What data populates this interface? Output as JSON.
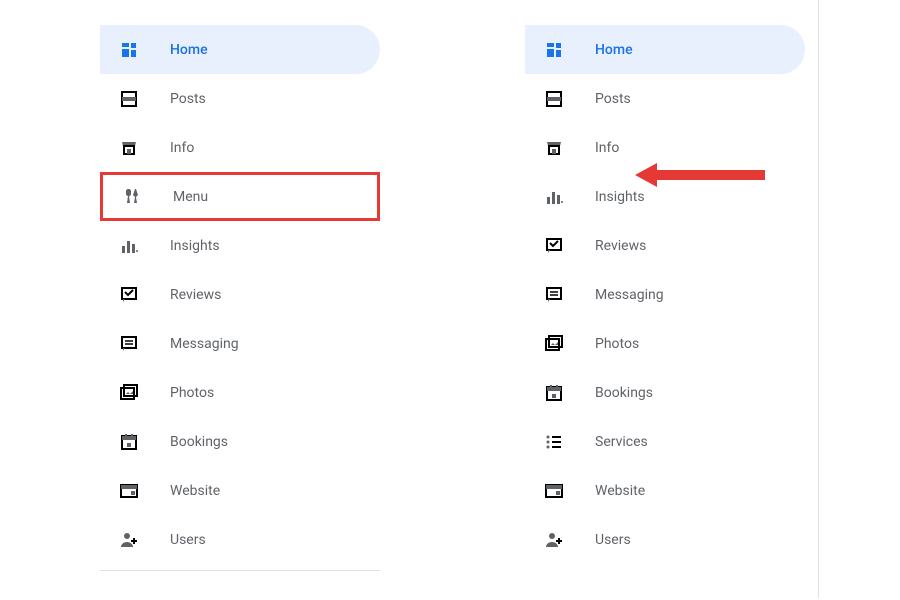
{
  "left_menu": {
    "items": [
      {
        "name": "home",
        "label": "Home",
        "icon": "dashboard",
        "active": true
      },
      {
        "name": "posts",
        "label": "Posts",
        "icon": "posts"
      },
      {
        "name": "info",
        "label": "Info",
        "icon": "store"
      },
      {
        "name": "menu",
        "label": "Menu",
        "icon": "utensils",
        "highlighted": true
      },
      {
        "name": "insights",
        "label": "Insights",
        "icon": "insights"
      },
      {
        "name": "reviews",
        "label": "Reviews",
        "icon": "reviews"
      },
      {
        "name": "messaging",
        "label": "Messaging",
        "icon": "messaging"
      },
      {
        "name": "photos",
        "label": "Photos",
        "icon": "photos"
      },
      {
        "name": "bookings",
        "label": "Bookings",
        "icon": "calendar"
      },
      {
        "name": "website",
        "label": "Website",
        "icon": "website"
      },
      {
        "name": "users",
        "label": "Users",
        "icon": "users"
      }
    ]
  },
  "right_menu": {
    "items": [
      {
        "name": "home",
        "label": "Home",
        "icon": "dashboard",
        "active": true
      },
      {
        "name": "posts",
        "label": "Posts",
        "icon": "posts"
      },
      {
        "name": "info",
        "label": "Info",
        "icon": "store"
      },
      {
        "name": "insights",
        "label": "Insights",
        "icon": "insights"
      },
      {
        "name": "reviews",
        "label": "Reviews",
        "icon": "reviews"
      },
      {
        "name": "messaging",
        "label": "Messaging",
        "icon": "messaging"
      },
      {
        "name": "photos",
        "label": "Photos",
        "icon": "photos"
      },
      {
        "name": "bookings",
        "label": "Bookings",
        "icon": "calendar"
      },
      {
        "name": "services",
        "label": "Services",
        "icon": "services"
      },
      {
        "name": "website",
        "label": "Website",
        "icon": "website"
      },
      {
        "name": "users",
        "label": "Users",
        "icon": "users"
      }
    ]
  },
  "annotations": {
    "arrow_target": "right_menu.info"
  }
}
